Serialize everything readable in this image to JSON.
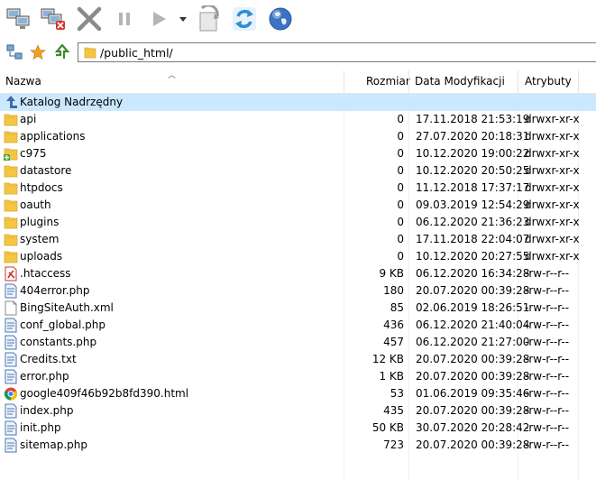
{
  "toolbar": {
    "buttons": [
      {
        "name": "connect-icon"
      },
      {
        "name": "disconnect-icon"
      },
      {
        "name": "cancel-icon"
      },
      {
        "name": "pause-icon"
      },
      {
        "name": "play-icon"
      },
      {
        "name": "dropdown-icon"
      },
      {
        "name": "queue-icon"
      },
      {
        "name": "refresh-icon"
      },
      {
        "name": "globe-icon"
      }
    ]
  },
  "address": {
    "path": "/public_html/"
  },
  "columns": {
    "name": "Nazwa",
    "size": "Rozmiar",
    "date": "Data Modyfikacji",
    "attrs": "Atrybuty"
  },
  "parent_row": {
    "label": "Katalog Nadrzędny"
  },
  "files": [
    {
      "name": "api",
      "size": "0",
      "date": "17.11.2018 21:53:19",
      "attrs": "drwxr-xr-x",
      "type": "folder"
    },
    {
      "name": "applications",
      "size": "0",
      "date": "27.07.2020 20:18:31",
      "attrs": "drwxr-xr-x",
      "type": "folder"
    },
    {
      "name": "c975",
      "size": "0",
      "date": "10.12.2020 19:00:22",
      "attrs": "drwxr-xr-x",
      "type": "folder-special"
    },
    {
      "name": "datastore",
      "size": "0",
      "date": "10.12.2020 20:50:25",
      "attrs": "drwxr-xr-x",
      "type": "folder"
    },
    {
      "name": "htpdocs",
      "size": "0",
      "date": "11.12.2018 17:37:17",
      "attrs": "drwxr-xr-x",
      "type": "folder"
    },
    {
      "name": "oauth",
      "size": "0",
      "date": "09.03.2019 12:54:29",
      "attrs": "drwxr-xr-x",
      "type": "folder"
    },
    {
      "name": "plugins",
      "size": "0",
      "date": "06.12.2020 21:36:23",
      "attrs": "drwxr-xr-x",
      "type": "folder"
    },
    {
      "name": "system",
      "size": "0",
      "date": "17.11.2018 22:04:07",
      "attrs": "drwxr-xr-x",
      "type": "folder"
    },
    {
      "name": "uploads",
      "size": "0",
      "date": "10.12.2020 20:27:55",
      "attrs": "drwxr-xr-x",
      "type": "folder"
    },
    {
      "name": ".htaccess",
      "size": "9 KB",
      "date": "06.12.2020 16:34:28",
      "attrs": "-rw-r--r--",
      "type": "htaccess"
    },
    {
      "name": "404error.php",
      "size": "180",
      "date": "20.07.2020 00:39:28",
      "attrs": "-rw-r--r--",
      "type": "php"
    },
    {
      "name": "BingSiteAuth.xml",
      "size": "85",
      "date": "02.06.2019 18:26:51",
      "attrs": "-rw-r--r--",
      "type": "blank"
    },
    {
      "name": "conf_global.php",
      "size": "436",
      "date": "06.12.2020 21:40:04",
      "attrs": "-rw-r--r--",
      "type": "php"
    },
    {
      "name": "constants.php",
      "size": "457",
      "date": "06.12.2020 21:27:00",
      "attrs": "-rw-r--r--",
      "type": "php"
    },
    {
      "name": "Credits.txt",
      "size": "12 KB",
      "date": "20.07.2020 00:39:28",
      "attrs": "-rw-r--r--",
      "type": "php"
    },
    {
      "name": "error.php",
      "size": "1 KB",
      "date": "20.07.2020 00:39:28",
      "attrs": "-rw-r--r--",
      "type": "php"
    },
    {
      "name": "google409f46b92b8fd390.html",
      "size": "53",
      "date": "01.06.2019 09:35:46",
      "attrs": "-rw-r--r--",
      "type": "chrome"
    },
    {
      "name": "index.php",
      "size": "435",
      "date": "20.07.2020 00:39:28",
      "attrs": "-rw-r--r--",
      "type": "php"
    },
    {
      "name": "init.php",
      "size": "50 KB",
      "date": "30.07.2020 20:28:42",
      "attrs": "-rw-r--r--",
      "type": "php"
    },
    {
      "name": "sitemap.php",
      "size": "723",
      "date": "20.07.2020 00:39:28",
      "attrs": "-rw-r--r--",
      "type": "php"
    }
  ],
  "colors": {
    "selection": "#cce8ff",
    "folder": "#f5c644",
    "refresh": "#2a8fd6"
  }
}
